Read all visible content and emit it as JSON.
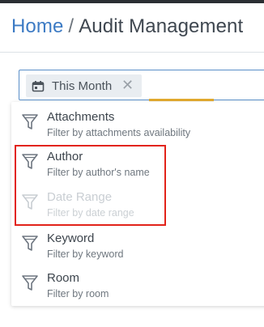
{
  "breadcrumb": {
    "home": "Home",
    "separator": "/",
    "current": "Audit Management"
  },
  "filter_chip": {
    "icon": "calendar-icon",
    "label": "This Month",
    "close_glyph": "✕"
  },
  "dropdown": {
    "items": [
      {
        "title": "Attachments",
        "description": "Filter by attachments availability",
        "icon": "filter-funnel-icon",
        "disabled": false
      },
      {
        "title": "Author",
        "description": "Filter by author's name",
        "icon": "filter-funnel-icon",
        "disabled": false
      },
      {
        "title": "Date Range",
        "description": "Filter by date range",
        "icon": "filter-funnel-icon",
        "disabled": true
      },
      {
        "title": "Keyword",
        "description": "Filter by keyword",
        "icon": "filter-funnel-icon",
        "disabled": false
      },
      {
        "title": "Room",
        "description": "Filter by room",
        "icon": "filter-funnel-icon",
        "disabled": false
      }
    ]
  },
  "colors": {
    "accent_blue": "#3d7bc4",
    "highlight_red": "#e2231a",
    "underline_gold": "#e3aa2f"
  }
}
